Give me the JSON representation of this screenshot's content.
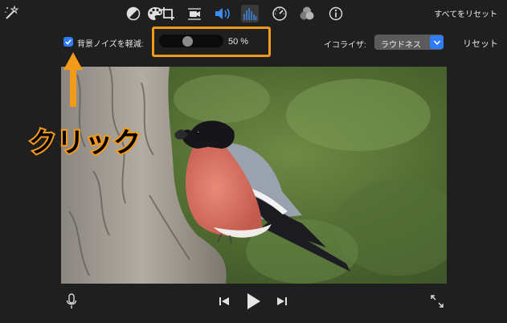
{
  "toolbar": {
    "tools": [
      {
        "icon": "magic-wand-icon"
      },
      {
        "icon": "color-balance-icon"
      },
      {
        "icon": "color-palette-icon"
      },
      {
        "icon": "crop-icon"
      },
      {
        "icon": "stabilization-icon"
      },
      {
        "icon": "volume-icon"
      },
      {
        "icon": "noise-reduction-equalizer-icon",
        "active": true
      },
      {
        "icon": "speed-icon"
      },
      {
        "icon": "clip-filter-icon"
      },
      {
        "icon": "info-icon"
      }
    ],
    "reset_all_label": "すべてをリセット"
  },
  "audio_controls": {
    "noise_reduction_checked": true,
    "noise_reduction_label": "背景ノイズを軽減:",
    "noise_reduction_value": 50,
    "noise_reduction_display": "50  %",
    "equalizer_label": "イコライザ:",
    "equalizer_value": "ラウドネス",
    "reset_label": "リセット"
  },
  "annotation": {
    "text": "クリック",
    "color": "#f39a1a"
  },
  "accent_color": "#2e7cf6",
  "playback": {
    "controls": [
      "microphone-icon",
      "skip-back-icon",
      "play-icon",
      "skip-forward-icon",
      "fullscreen-icon"
    ]
  }
}
